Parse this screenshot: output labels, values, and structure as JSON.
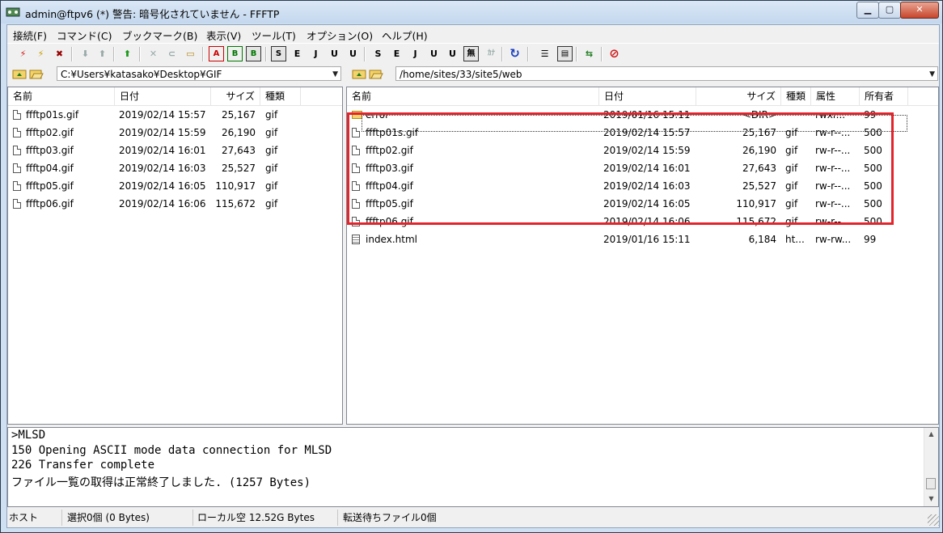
{
  "window": {
    "title": "admin@ftpv6 (*) 警告: 暗号化されていません - FFFTP",
    "min_label": "▁",
    "max_label": "▢",
    "close_label": "✕"
  },
  "menu": [
    "接続(F)",
    "コマンド(C)",
    "ブックマーク(B)",
    "表示(V)",
    "ツール(T)",
    "オプション(O)",
    "ヘルプ(H)"
  ],
  "toolbar": {
    "connect": "⚡",
    "quick_connect": "⚡",
    "disconnect": "✖",
    "download": "⬇",
    "upload": "⬆",
    "mirror_upload": "⬆",
    "delete": "✕",
    "rename": "⊂",
    "mkdir": "▭",
    "mode_a": "A",
    "mode_b": "B",
    "mode_auto": "B",
    "host_kanji_sjis": "S",
    "host_kanji_euc": "E",
    "host_kanji_jis": "J",
    "host_kanji_utf8": "U",
    "host_kanji_utf8n": "U",
    "local_kanji_sjis": "S",
    "local_kanji_euc": "E",
    "local_kanji_jis": "J",
    "local_kanji_utf8": "U",
    "local_kanji_utf8n": "U",
    "no_convert": "無",
    "kana_convert": "ｶﾅ",
    "refresh": "↻",
    "list_view": "☰",
    "detail_view": "▤",
    "compare": "⇆",
    "stop": "⊘"
  },
  "local": {
    "path": "C:¥Users¥katasako¥Desktop¥GIF",
    "columns": [
      "名前",
      "日付",
      "サイズ",
      "種類"
    ],
    "files": [
      {
        "name": "ffftp01s.gif",
        "date": "2019/02/14 15:57",
        "size": "25,167",
        "type": "gif"
      },
      {
        "name": "ffftp02.gif",
        "date": "2019/02/14 15:59",
        "size": "26,190",
        "type": "gif"
      },
      {
        "name": "ffftp03.gif",
        "date": "2019/02/14 16:01",
        "size": "27,643",
        "type": "gif"
      },
      {
        "name": "ffftp04.gif",
        "date": "2019/02/14 16:03",
        "size": "25,527",
        "type": "gif"
      },
      {
        "name": "ffftp05.gif",
        "date": "2019/02/14 16:05",
        "size": "110,917",
        "type": "gif"
      },
      {
        "name": "ffftp06.gif",
        "date": "2019/02/14 16:06",
        "size": "115,672",
        "type": "gif"
      }
    ]
  },
  "remote": {
    "path": "/home/sites/33/site5/web",
    "columns": [
      "名前",
      "日付",
      "サイズ",
      "種類",
      "属性",
      "所有者"
    ],
    "files": [
      {
        "icon": "folder",
        "name": "error",
        "date": "2019/01/16 15:11",
        "size": "<DIR>",
        "type": "",
        "attr": "rwxr...",
        "owner": "99"
      },
      {
        "icon": "file",
        "name": "ffftp01s.gif",
        "date": "2019/02/14 15:57",
        "size": "25,167",
        "type": "gif",
        "attr": "rw-r--...",
        "owner": "500"
      },
      {
        "icon": "file",
        "name": "ffftp02.gif",
        "date": "2019/02/14 15:59",
        "size": "26,190",
        "type": "gif",
        "attr": "rw-r--...",
        "owner": "500"
      },
      {
        "icon": "file",
        "name": "ffftp03.gif",
        "date": "2019/02/14 16:01",
        "size": "27,643",
        "type": "gif",
        "attr": "rw-r--...",
        "owner": "500"
      },
      {
        "icon": "file",
        "name": "ffftp04.gif",
        "date": "2019/02/14 16:03",
        "size": "25,527",
        "type": "gif",
        "attr": "rw-r--...",
        "owner": "500"
      },
      {
        "icon": "file",
        "name": "ffftp05.gif",
        "date": "2019/02/14 16:05",
        "size": "110,917",
        "type": "gif",
        "attr": "rw-r--...",
        "owner": "500"
      },
      {
        "icon": "file",
        "name": "ffftp06.gif",
        "date": "2019/02/14 16:06",
        "size": "115,672",
        "type": "gif",
        "attr": "rw-r--...",
        "owner": "500"
      },
      {
        "icon": "doc",
        "name": "index.html",
        "date": "2019/01/16 15:11",
        "size": "6,184",
        "type": "ht...",
        "attr": "rw-rw...",
        "owner": "99"
      }
    ]
  },
  "log": [
    ">MLSD",
    "150 Opening ASCII mode data connection for MLSD",
    "226 Transfer complete",
    "ファイル一覧の取得は正常終了しました. (1257 Bytes)"
  ],
  "status": {
    "host": "ホスト",
    "selection": "選択0個 (0 Bytes)",
    "local_free": "ローカル空 12.52G Bytes",
    "queue": "転送待ちファイル0個"
  },
  "colors": {
    "highlight": "#e3242b",
    "titlebar": "#c3d7ee"
  }
}
